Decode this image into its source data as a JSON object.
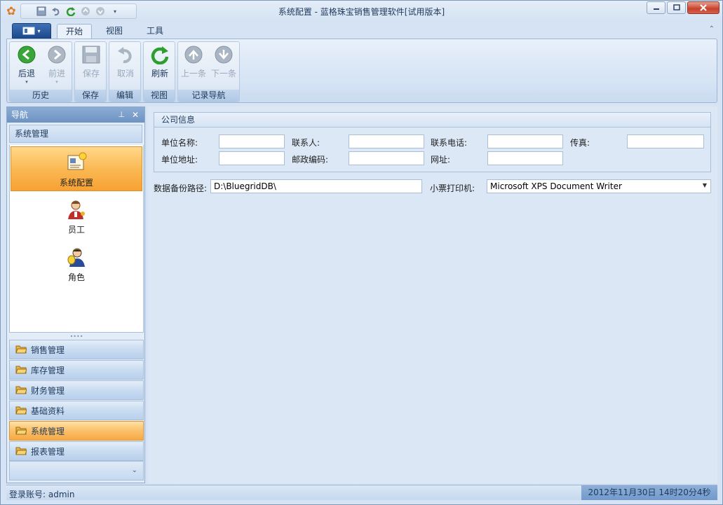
{
  "window": {
    "title": "系统配置 - 蓝格珠宝销售管理软件[试用版本]"
  },
  "ribbon": {
    "tabs": [
      {
        "label": "开始",
        "active": true
      },
      {
        "label": "视图",
        "active": false
      },
      {
        "label": "工具",
        "active": false
      }
    ],
    "groups": {
      "history": {
        "label": "历史",
        "back": "后退",
        "forward": "前进"
      },
      "save": {
        "label": "保存",
        "save": "保存"
      },
      "edit": {
        "label": "编辑",
        "cancel": "取消"
      },
      "view": {
        "label": "视图",
        "refresh": "刷新"
      },
      "nav": {
        "label": "记录导航",
        "prev": "上一条",
        "next": "下一条"
      }
    }
  },
  "nav": {
    "header": "导航",
    "section_title": "系统管理",
    "items": [
      {
        "label": "系统配置",
        "icon": "settings-document-icon",
        "selected": true
      },
      {
        "label": "员工",
        "icon": "employee-icon",
        "selected": false
      },
      {
        "label": "角色",
        "icon": "role-icon",
        "selected": false
      }
    ],
    "groups": [
      {
        "label": "销售管理",
        "active": false
      },
      {
        "label": "库存管理",
        "active": false
      },
      {
        "label": "财务管理",
        "active": false
      },
      {
        "label": "基础资料",
        "active": false
      },
      {
        "label": "系统管理",
        "active": true
      },
      {
        "label": "报表管理",
        "active": false
      }
    ]
  },
  "form": {
    "company_group_title": "公司信息",
    "unit_name_label": "单位名称:",
    "unit_name_value": "",
    "contact_label": "联系人:",
    "contact_value": "",
    "phone_label": "联系电话:",
    "phone_value": "",
    "fax_label": "传真:",
    "fax_value": "",
    "address_label": "单位地址:",
    "address_value": "",
    "postcode_label": "邮政编码:",
    "postcode_value": "",
    "website_label": "网址:",
    "website_value": "",
    "backup_path_label": "数据备份路径:",
    "backup_path_value": "D:\\BluegridDB\\",
    "printer_label": "小票打印机:",
    "printer_value": "Microsoft XPS Document Writer"
  },
  "status": {
    "login": "登录账号: admin",
    "datetime": "2012年11月30日 14时20分4秒"
  },
  "colors": {
    "accent": "#fbb954",
    "ribbon_bg": "#d5e3f4",
    "nav_header": "#6e93c3"
  }
}
